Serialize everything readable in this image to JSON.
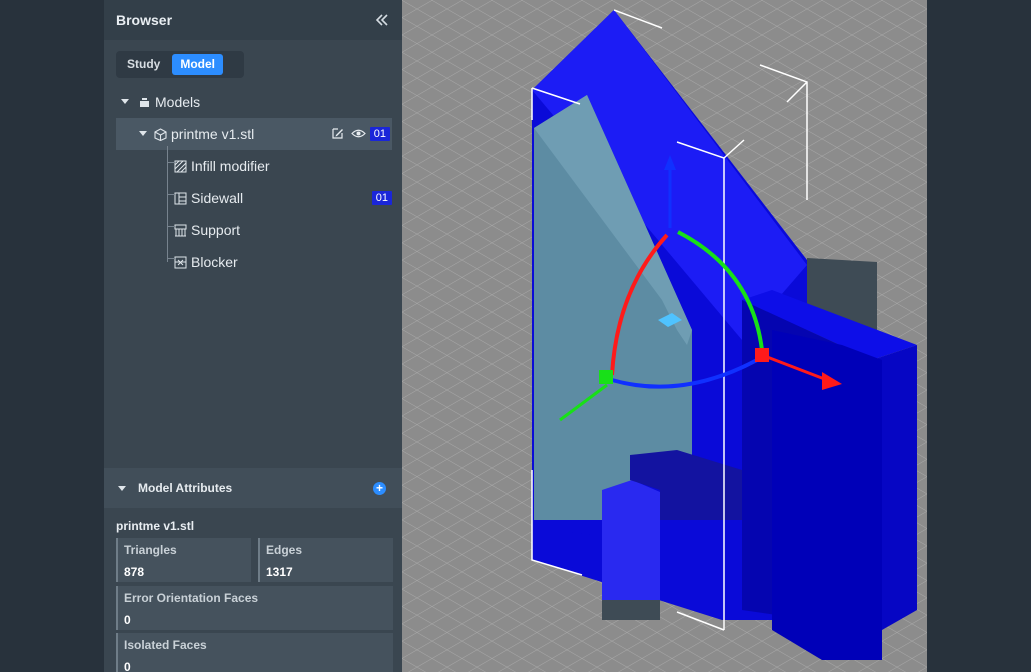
{
  "browser": {
    "title": "Browser",
    "tabs": [
      {
        "label": "Study",
        "active": false
      },
      {
        "label": "Model",
        "active": true
      }
    ],
    "tree": {
      "root_label": "Models",
      "model_name": "printme v1.stl",
      "model_badge": "01",
      "children": [
        {
          "label": "Infill modifier",
          "icon": "infill-icon",
          "badge": ""
        },
        {
          "label": "Sidewall",
          "icon": "sidewall-icon",
          "badge": "01"
        },
        {
          "label": "Support",
          "icon": "support-icon",
          "badge": ""
        },
        {
          "label": "Blocker",
          "icon": "blocker-icon",
          "badge": ""
        }
      ]
    }
  },
  "attributes": {
    "title": "Model Attributes",
    "file_name": "printme v1.stl",
    "triangles_label": "Triangles",
    "triangles_value": "878",
    "edges_label": "Edges",
    "edges_value": "1317",
    "error_label": "Error Orientation Faces",
    "error_value": "0",
    "isolated_label": "Isolated Faces",
    "isolated_value": "0"
  },
  "colors": {
    "accent": "#2c8dff",
    "badge": "#1a26d9",
    "model": "#0a0ad8",
    "gizmo_x": "#ff1a1a",
    "gizmo_y": "#18e018",
    "gizmo_z": "#1030ff"
  }
}
